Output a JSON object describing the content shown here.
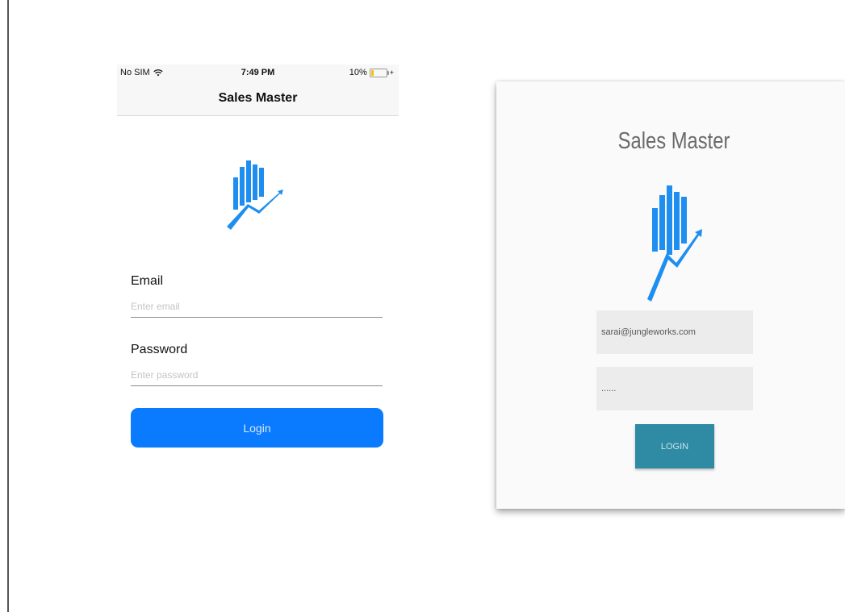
{
  "ios": {
    "status": {
      "carrier": "No SIM",
      "time": "7:49 PM",
      "battery": "10%"
    },
    "nav_title": "Sales Master",
    "email_label": "Email",
    "email_placeholder": "Enter email",
    "password_label": "Password",
    "password_placeholder": "Enter password",
    "login_label": "Login",
    "colors": {
      "accent": "#0a7bff",
      "logo": "#1e8ff0"
    }
  },
  "web": {
    "title": "Sales Master",
    "email_value": "sarai@jungleworks.com",
    "password_value": "......",
    "login_label": "LOGIN",
    "colors": {
      "button": "#2f8ba3",
      "logo": "#1e8ff0",
      "field": "#ececec"
    }
  }
}
